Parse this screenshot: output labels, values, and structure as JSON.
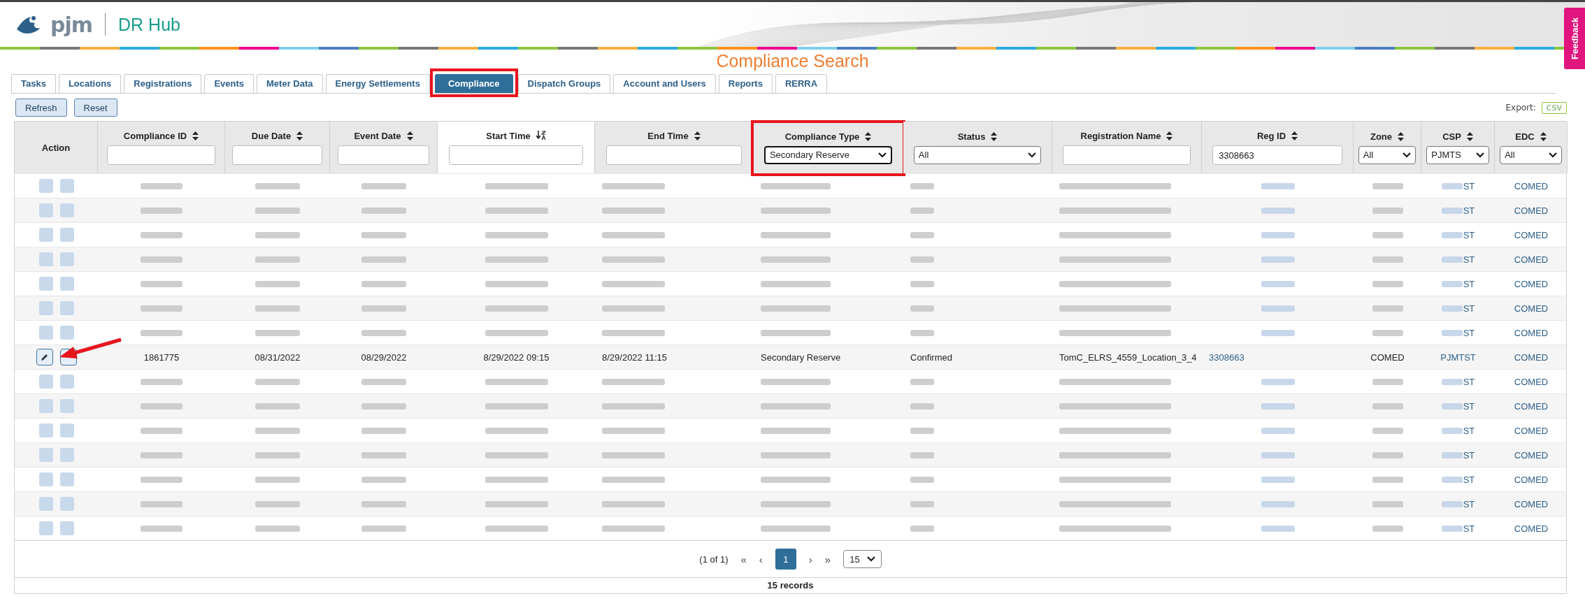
{
  "header": {
    "logo": "pjm",
    "app_name": "DR Hub",
    "feedback": "Feedback"
  },
  "page_title": "Compliance Search",
  "tabs": [
    {
      "label": "Tasks",
      "selected": false
    },
    {
      "label": "Locations",
      "selected": false
    },
    {
      "label": "Registrations",
      "selected": false
    },
    {
      "label": "Events",
      "selected": false
    },
    {
      "label": "Meter Data",
      "selected": false
    },
    {
      "label": "Energy Settlements",
      "selected": false
    },
    {
      "label": "Compliance",
      "selected": true,
      "highlighted": true
    },
    {
      "label": "Dispatch Groups",
      "selected": false
    },
    {
      "label": "Account and Users",
      "selected": false
    },
    {
      "label": "Reports",
      "selected": false
    },
    {
      "label": "RERRA",
      "selected": false
    }
  ],
  "toolbar": {
    "buttons": [
      "Refresh",
      "Reset"
    ],
    "export_label": "Export:",
    "export_button": "CSV"
  },
  "table": {
    "columns": [
      {
        "label": "Action"
      },
      {
        "label": "Compliance ID",
        "sorted": false,
        "filter": {
          "kind": "text"
        }
      },
      {
        "label": "Due Date",
        "sorted": false,
        "filter": {
          "kind": "text"
        }
      },
      {
        "label": "Event Date",
        "sorted": false,
        "filter": {
          "kind": "text"
        }
      },
      {
        "label": "Start Time",
        "sorted": true,
        "filter": {
          "kind": "text"
        }
      },
      {
        "label": "End Time",
        "sorted": false,
        "filter": {
          "kind": "text"
        }
      },
      {
        "label": "Compliance Type",
        "sorted": false,
        "highlighted": true,
        "filter": {
          "kind": "select",
          "value": "Secondary Reserve",
          "focused": true
        }
      },
      {
        "label": "Status",
        "sorted": false,
        "filter": {
          "kind": "select",
          "value": "All",
          "focused": false
        }
      },
      {
        "label": "Registration Name",
        "sorted": false,
        "filter": {
          "kind": "text"
        }
      },
      {
        "label": "Reg ID",
        "sorted": false,
        "link": true,
        "filter": {
          "kind": "text",
          "value": "3308663"
        }
      },
      {
        "label": "Zone",
        "sorted": false,
        "filter": {
          "kind": "select",
          "value": "All",
          "focused": false
        }
      },
      {
        "label": "CSP",
        "sorted": false,
        "link": true,
        "filter": {
          "kind": "select",
          "value": "PJMTS",
          "focused": false
        }
      },
      {
        "label": "EDC",
        "sorted": false,
        "link": true,
        "filter": {
          "kind": "select",
          "value": "All",
          "focused": false
        }
      }
    ],
    "rows": [
      {
        "blurred": true,
        "csp_tail": "ST",
        "edc": "COMED"
      },
      {
        "blurred": true,
        "csp_tail": "ST",
        "edc": "COMED"
      },
      {
        "blurred": true,
        "csp_tail": "ST",
        "edc": "COMED"
      },
      {
        "blurred": true,
        "csp_tail": "ST",
        "edc": "COMED"
      },
      {
        "blurred": true,
        "csp_tail": "ST",
        "edc": "COMED"
      },
      {
        "blurred": true,
        "csp_tail": "ST",
        "edc": "COMED"
      },
      {
        "blurred": true,
        "csp_tail": "ST",
        "edc": "COMED"
      },
      {
        "blurred": false,
        "pointed": true,
        "cells": [
          "1861775",
          "08/31/2022",
          "08/29/2022",
          "8/29/2022 09:15",
          "8/29/2022 11:15",
          "Secondary Reserve",
          "Confirmed",
          "TomC_ELRS_4559_Location_3_4",
          "3308663",
          "COMED",
          "PJMTST",
          "COMED"
        ]
      },
      {
        "blurred": true,
        "csp_tail": "ST",
        "edc": "COMED"
      },
      {
        "blurred": true,
        "csp_tail": "ST",
        "edc": "COMED"
      },
      {
        "blurred": true,
        "csp_tail": "ST",
        "edc": "COMED"
      },
      {
        "blurred": true,
        "csp_tail": "ST",
        "edc": "COMED"
      },
      {
        "blurred": true,
        "csp_tail": "ST",
        "edc": "COMED"
      },
      {
        "blurred": true,
        "csp_tail": "ST",
        "edc": "COMED"
      },
      {
        "blurred": true,
        "csp_tail": "ST",
        "edc": "COMED"
      }
    ]
  },
  "pager": {
    "info": "(1 of 1)",
    "first": "«",
    "prev": "‹",
    "pages": [
      {
        "label": "1",
        "selected": true
      }
    ],
    "next": "›",
    "last": "»",
    "page_size": "15"
  },
  "records": "15 records"
}
